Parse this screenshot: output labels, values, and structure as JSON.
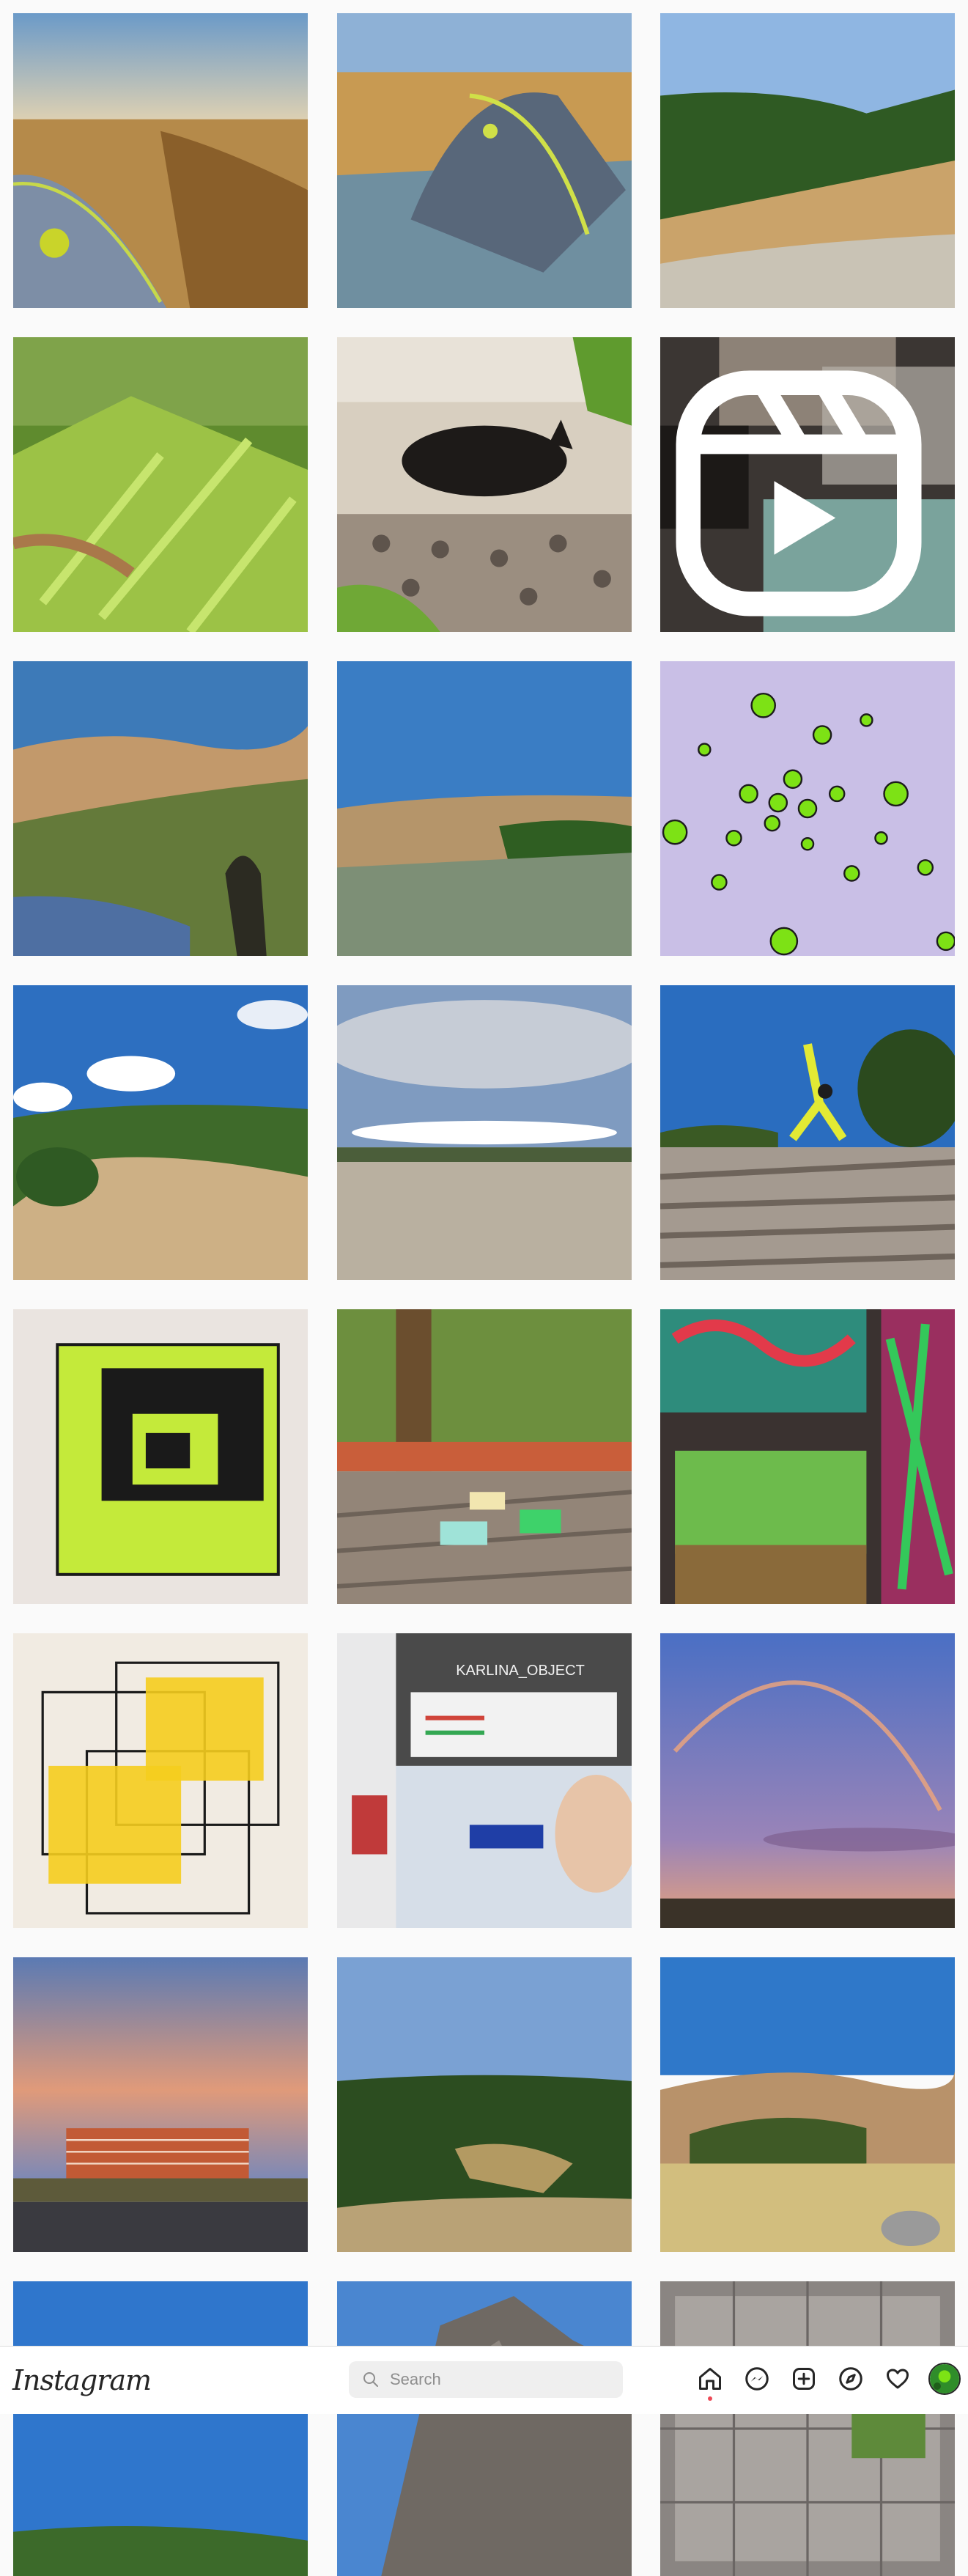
{
  "app": {
    "name": "Instagram"
  },
  "search": {
    "placeholder": "Search"
  },
  "nav": {
    "items": [
      {
        "name": "home-icon",
        "label": "Home",
        "active": true
      },
      {
        "name": "messenger-icon",
        "label": "Messenger"
      },
      {
        "name": "new-post-icon",
        "label": "New Post"
      },
      {
        "name": "explore-icon",
        "label": "Explore"
      },
      {
        "name": "activity-heart-icon",
        "label": "Activity"
      },
      {
        "name": "profile-avatar",
        "label": "Profile"
      }
    ],
    "notification_color": "#ed4956"
  },
  "grid": {
    "columns": 3,
    "posts": [
      {
        "subject": "tent-in-dry-grass"
      },
      {
        "subject": "tent-on-hillside"
      },
      {
        "subject": "green-hills-valley"
      },
      {
        "subject": "ferns-sunlight"
      },
      {
        "subject": "black-cat-on-stones"
      },
      {
        "subject": "dark-room-reel",
        "reel": true
      },
      {
        "subject": "golden-hills-shadow"
      },
      {
        "subject": "hilltop-brush"
      },
      {
        "subject": "green-dots-pattern"
      },
      {
        "subject": "hills-clouds"
      },
      {
        "subject": "empty-field-clouds"
      },
      {
        "subject": "yoga-on-driftwood"
      },
      {
        "subject": "green-cube-drawing"
      },
      {
        "subject": "garden-glass-blocks"
      },
      {
        "subject": "graffiti-underpass"
      },
      {
        "subject": "yellow-cubes-drawing"
      },
      {
        "subject": "laptop-usb-drive",
        "screen_title": "KARLINA_OBJECT"
      },
      {
        "subject": "rainbow-sunset"
      },
      {
        "subject": "pink-sky-building"
      },
      {
        "subject": "forested-hills"
      },
      {
        "subject": "golden-hills-meadow"
      },
      {
        "subject": "blue-sky-partial"
      },
      {
        "subject": "rocky-peak-partial"
      },
      {
        "subject": "window-screen-partial"
      }
    ]
  }
}
